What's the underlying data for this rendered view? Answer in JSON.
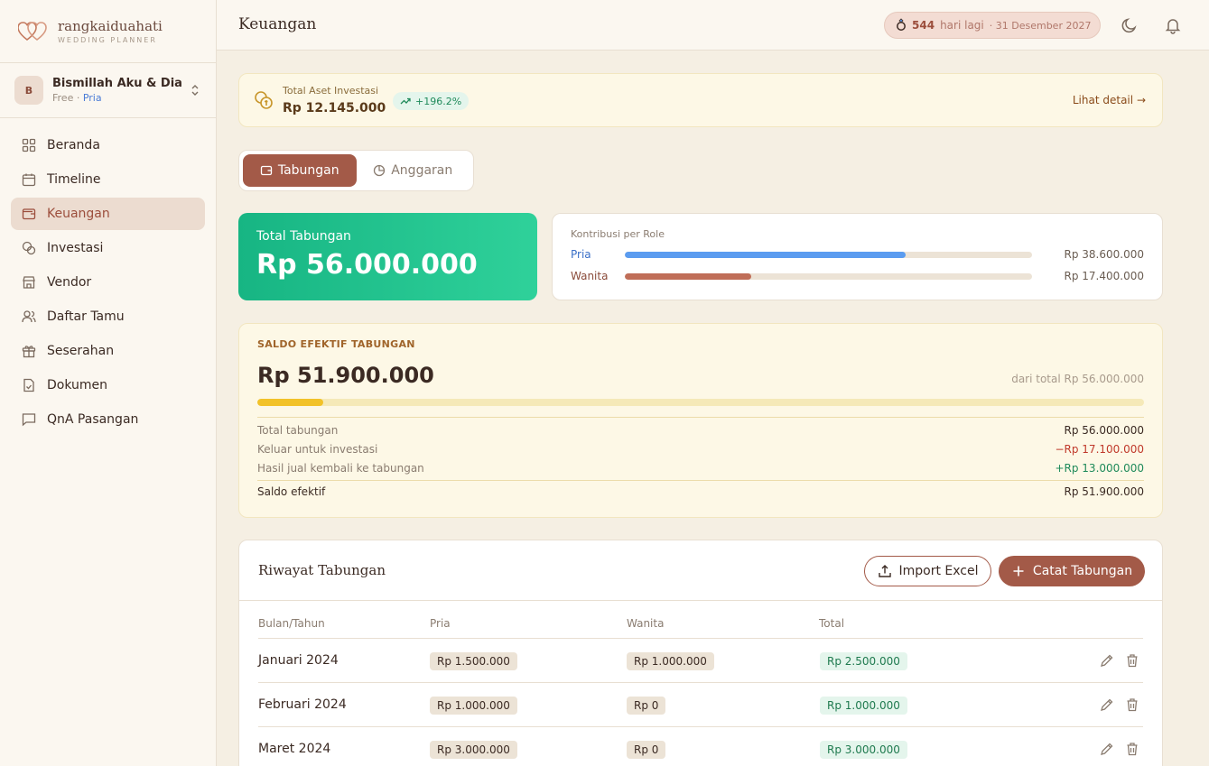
{
  "brand": {
    "name": "rangkaiduahati",
    "tagline": "WEDDING PLANNER",
    "icon": "double-heart-icon"
  },
  "account": {
    "initial": "B",
    "name": "Bismillah Aku & Dia",
    "plan": "Free",
    "separator": "·",
    "role": "Pria"
  },
  "nav": [
    {
      "label": "Beranda",
      "icon": "grid-icon"
    },
    {
      "label": "Timeline",
      "icon": "calendar-icon"
    },
    {
      "label": "Keuangan",
      "icon": "wallet-icon",
      "active": true
    },
    {
      "label": "Investasi",
      "icon": "coins-icon"
    },
    {
      "label": "Vendor",
      "icon": "store-icon"
    },
    {
      "label": "Daftar Tamu",
      "icon": "users-icon"
    },
    {
      "label": "Seserahan",
      "icon": "gift-icon"
    },
    {
      "label": "Dokumen",
      "icon": "file-check-icon"
    },
    {
      "label": "QnA Pasangan",
      "icon": "chat-icon"
    }
  ],
  "header": {
    "title": "Keuangan",
    "countdown": {
      "days": "544",
      "label": "hari lagi",
      "date": "· 31 Desember 2027",
      "icon": "ring-icon"
    }
  },
  "assets": {
    "label": "Total Aset Investasi",
    "value": "Rp 12.145.000",
    "change": "+196.2%",
    "link": "Lihat detail"
  },
  "tabs": [
    {
      "label": "Tabungan",
      "icon": "wallet-icon"
    },
    {
      "label": "Anggaran",
      "icon": "pie-icon"
    }
  ],
  "total": {
    "label": "Total Tabungan",
    "value": "Rp 56.000.000"
  },
  "contrib": {
    "title": "Kontribusi per Role",
    "rows": [
      {
        "name": "Pria",
        "amount": "Rp 38.600.000",
        "share": 0.689,
        "color": "#5b9cf0",
        "text_color": "#3a6fc7"
      },
      {
        "name": "Wanita",
        "amount": "Rp 17.400.000",
        "share": 0.311,
        "color": "#c06e58",
        "text_color": "#8a4b3a"
      }
    ]
  },
  "saldo": {
    "title": "SALDO EFEKTIF TABUNGAN",
    "value": "Rp 51.900.000",
    "from": "dari total Rp 56.000.000",
    "progress": 0.074,
    "lines": [
      {
        "label": "Total tabungan",
        "value": "Rp 56.000.000",
        "tone": "v"
      },
      {
        "label": "Keluar untuk investasi",
        "value": "−Rp 17.100.000",
        "tone": "neg"
      },
      {
        "label": "Hasil jual kembali ke tabungan",
        "value": "+Rp 13.000.000",
        "tone": "pos"
      }
    ],
    "final": {
      "label": "Saldo efektif",
      "value": "Rp 51.900.000"
    }
  },
  "history": {
    "title": "Riwayat Tabungan",
    "import_label": "Import Excel",
    "add_label": "Catat Tabungan",
    "columns": [
      "Bulan/Tahun",
      "Pria",
      "Wanita",
      "Total"
    ],
    "rows": [
      {
        "month": "Januari 2024",
        "pria": "Rp 1.500.000",
        "wanita": "Rp 1.000.000",
        "total": "Rp 2.500.000"
      },
      {
        "month": "Februari 2024",
        "pria": "Rp 1.000.000",
        "wanita": "Rp 0",
        "total": "Rp 1.000.000"
      },
      {
        "month": "Maret 2024",
        "pria": "Rp 3.000.000",
        "wanita": "Rp 0",
        "total": "Rp 3.000.000"
      }
    ]
  }
}
